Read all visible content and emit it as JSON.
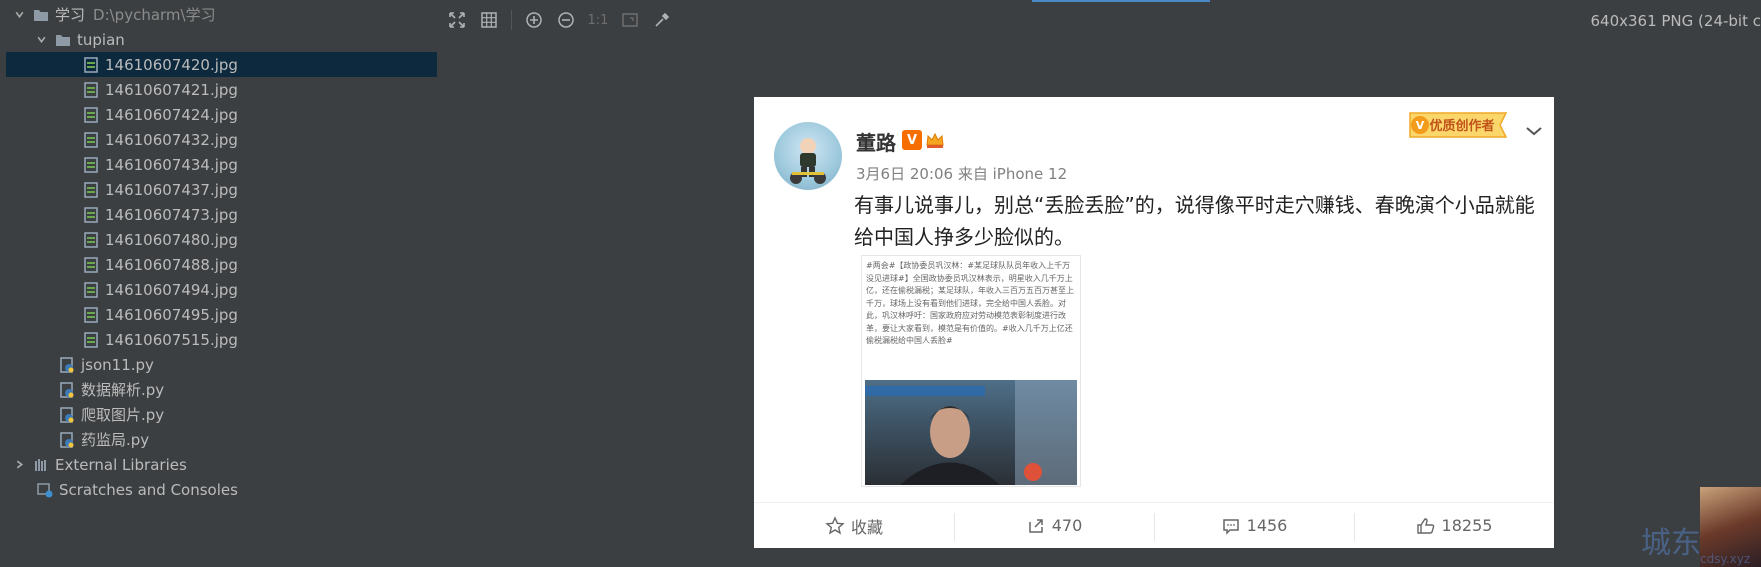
{
  "project_tree": {
    "root": {
      "label": "学习",
      "path": "D:\\pycharm\\学习"
    },
    "folder": {
      "label": "tupian"
    },
    "images": [
      "14610607420.jpg",
      "14610607421.jpg",
      "14610607424.jpg",
      "14610607432.jpg",
      "14610607434.jpg",
      "14610607437.jpg",
      "14610607473.jpg",
      "14610607480.jpg",
      "14610607488.jpg",
      "14610607494.jpg",
      "14610607495.jpg",
      "14610607515.jpg"
    ],
    "scripts": [
      "json11.py",
      "数据解析.py",
      "爬取图片.py",
      "药监局.py"
    ],
    "external_libraries": "External Libraries",
    "scratches": "Scratches and Consoles"
  },
  "viewer": {
    "zoom_actual_label": "1:1",
    "image_info": "640x361 PNG (24-bit c"
  },
  "post": {
    "author": "董路",
    "verified_badge": "V",
    "meta": "3月6日 20:06 来自 iPhone 12",
    "ribbon": "优质创作者",
    "content": "有事儿说事儿，别总“丢脸丢脸”的，说得像平时走穴赚钱、春晚演个小品就能给中国人挣多少脸似的。",
    "embedded_text": "#两会#【政协委员巩汉林：#某足球队队员年收入上千万没见进球#】全国政协委员巩汉林表示，明星收入几千万上亿，还在偷税漏税；某足球队，年收入三百万五百万甚至上千万，球场上没有看到他们进球，完全给中国人丢脸。对此，巩汉林呼吁：国家政府应对劳动模范表彰制度进行改革，要让大家看到，模范是有价值的。#收入几千万上亿还偷税漏税给中国人丢脸#",
    "actions": {
      "favorite": "收藏",
      "repost": "470",
      "comment": "1456",
      "like": "18255"
    }
  },
  "watermark": {
    "main": "城东",
    "small": "cdsy.xyz"
  },
  "colors": {
    "ide_background": "#3c3f41",
    "selection": "#0d293e",
    "accent": "#4a88c7",
    "weibo_orange": "#f76e00"
  }
}
